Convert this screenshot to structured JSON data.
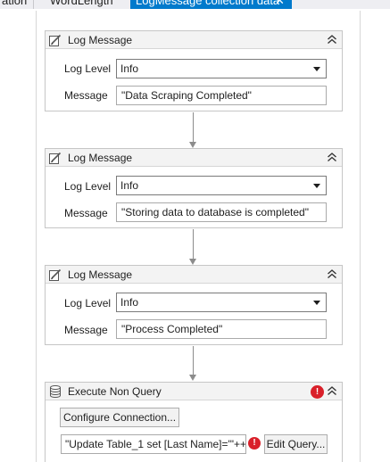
{
  "tabs": [
    {
      "label": "ation"
    },
    {
      "label": "WordLength"
    },
    {
      "label": "LogMessage collection data",
      "close": "✕"
    }
  ],
  "log_level_label": "Log Level",
  "message_label": "Message",
  "activities": [
    {
      "title": "Log Message",
      "level": "Info",
      "message": "\"Data Scraping Completed\""
    },
    {
      "title": "Log Message",
      "level": "Info",
      "message": "\"Storing data to database is completed\""
    },
    {
      "title": "Log Message",
      "level": "Info",
      "message": "\"Process Completed\""
    }
  ],
  "execute": {
    "title": "Execute Non Query",
    "configure_label": "Configure Connection...",
    "sql": "\"Update Table_1 set [Last Name]='\"++",
    "edit_label": "Edit Query...",
    "error_glyph": "!"
  },
  "colors": {
    "accent_tab": "#007acc",
    "error": "#d9202a"
  }
}
